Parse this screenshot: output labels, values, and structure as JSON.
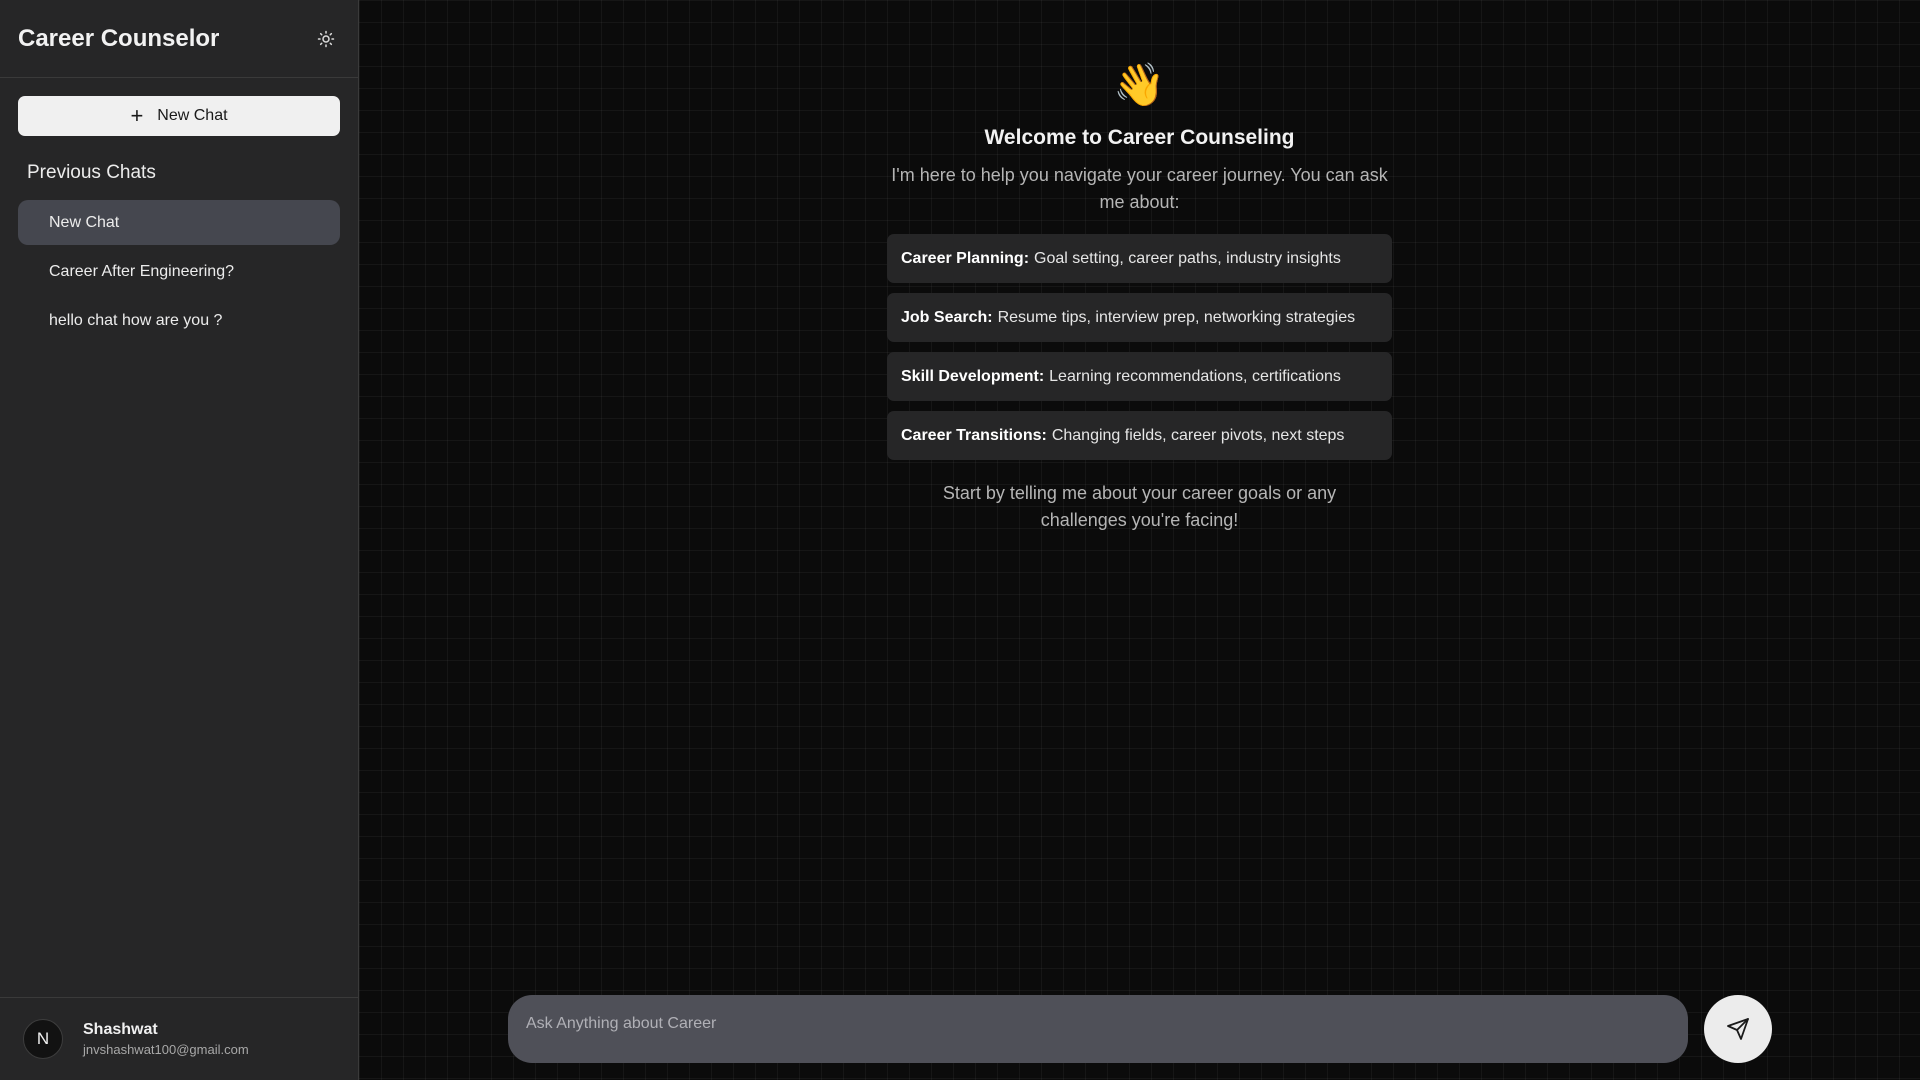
{
  "sidebar": {
    "title": "Career Counselor",
    "theme_icon": "sun-icon",
    "new_chat_label": "New Chat",
    "previous_chats_heading": "Previous Chats",
    "chats": [
      {
        "label": "New Chat",
        "active": true
      },
      {
        "label": "Career After Engineering?",
        "active": false
      },
      {
        "label": "hello chat how are you ?",
        "active": false
      }
    ],
    "user": {
      "initial": "N",
      "name": "Shashwat",
      "email": "jnvshashwat100@gmail.com"
    }
  },
  "main": {
    "emoji": "👋",
    "title": "Welcome to Career Counseling",
    "description": "I'm here to help you navigate your career journey. You can ask me about:",
    "topics": [
      {
        "heading": "Career Planning:",
        "text": "Goal setting, career paths, industry insights"
      },
      {
        "heading": "Job Search:",
        "text": "Resume tips, interview prep, networking strategies"
      },
      {
        "heading": "Skill Development:",
        "text": "Learning recommendations, certifications"
      },
      {
        "heading": "Career Transitions:",
        "text": "Changing fields, career pivots, next steps"
      }
    ],
    "closing": "Start by telling me about your career goals or any challenges you're facing!",
    "input_placeholder": "Ask Anything about Career",
    "send_icon": "send-icon"
  },
  "colors": {
    "sidebar_bg": "#262627",
    "main_bg": "#0b0b0b",
    "active_item": "#45474f",
    "composer_bg": "#4f5058"
  }
}
